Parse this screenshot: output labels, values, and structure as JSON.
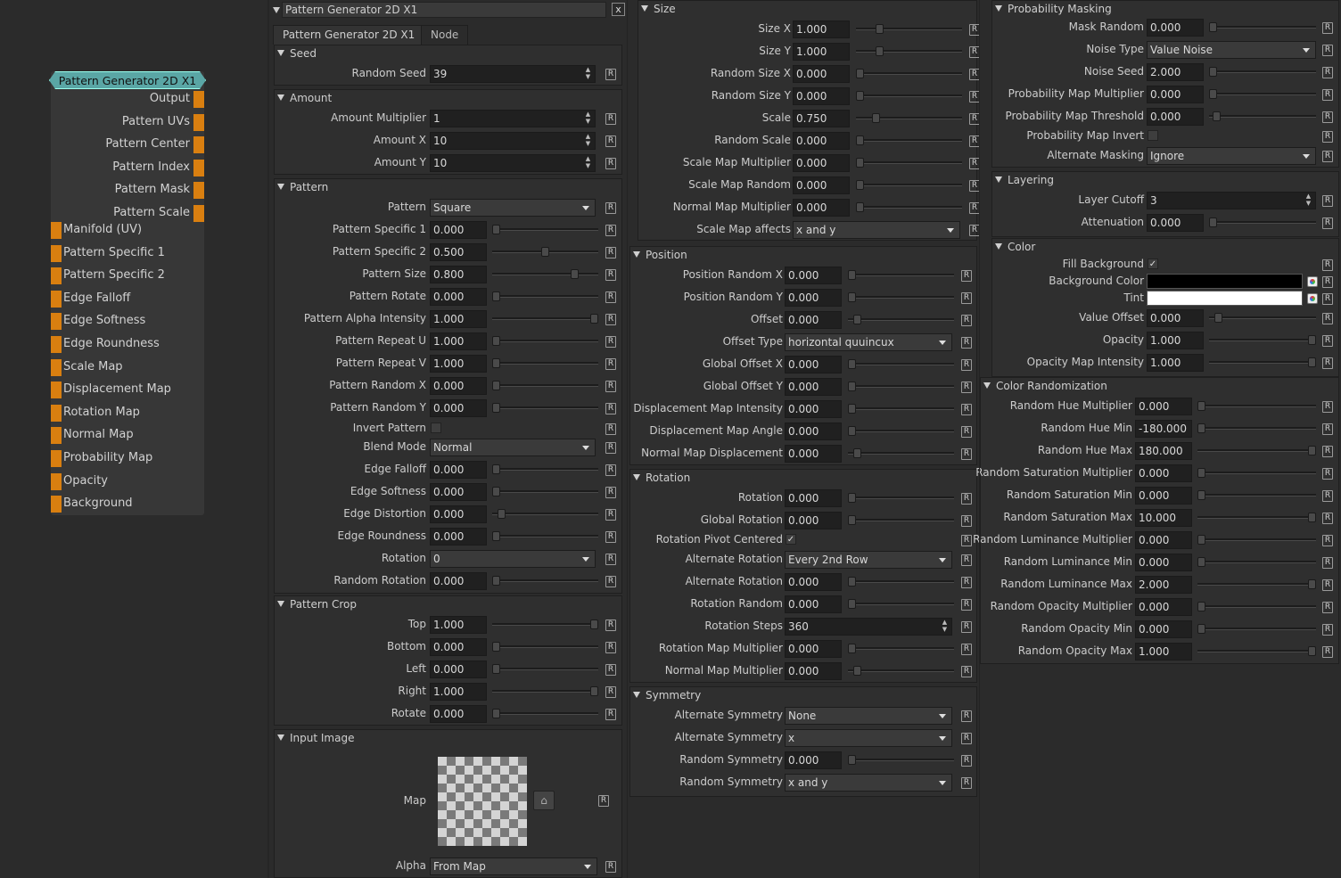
{
  "node": {
    "title": "Pattern Generator 2D X1",
    "outputs": [
      "Output",
      "Pattern UVs",
      "Pattern Center",
      "Pattern Index",
      "Pattern Mask",
      "Pattern Scale"
    ],
    "inputs": [
      "Manifold (UV)",
      "Pattern Specific 1",
      "Pattern Specific 2",
      "Edge Falloff",
      "Edge Softness",
      "Edge Roundness",
      "Scale Map",
      "Displacement Map",
      "Rotation Map",
      "Normal Map",
      "Probability Map",
      "Opacity",
      "Background"
    ],
    "port_color": "#d97f10",
    "title_color": "#5aa6a5"
  },
  "panel": {
    "header_title": "Pattern Generator 2D X1",
    "close_label": "x",
    "tabs": [
      "Pattern Generator 2D X1",
      "Node"
    ],
    "reset_label": "R"
  },
  "col1": [
    {
      "title": "Seed",
      "rows": [
        {
          "label": "Random Seed",
          "value": "39",
          "kind": "spin"
        }
      ]
    },
    {
      "title": "Amount",
      "rows": [
        {
          "label": "Amount Multiplier",
          "value": "1",
          "kind": "spin"
        },
        {
          "label": "Amount X",
          "value": "10",
          "kind": "spin"
        },
        {
          "label": "Amount Y",
          "value": "10",
          "kind": "spin"
        }
      ]
    },
    {
      "title": "Pattern",
      "rows": [
        {
          "label": "Pattern",
          "value": "Square",
          "kind": "dropdown"
        },
        {
          "label": "Pattern Specific 1",
          "value": "0.000",
          "kind": "slider",
          "level": 0
        },
        {
          "label": "Pattern Specific 2",
          "value": "0.500",
          "kind": "slider",
          "level": 0.5
        },
        {
          "label": "Pattern Size",
          "value": "0.800",
          "kind": "slider",
          "level": 0.8
        },
        {
          "label": "Pattern Rotate",
          "value": "0.000",
          "kind": "slider",
          "level": 0
        },
        {
          "label": "Pattern Alpha Intensity",
          "value": "1.000",
          "kind": "slider",
          "level": 1
        },
        {
          "label": "Pattern Repeat U",
          "value": "1.000",
          "kind": "slider",
          "level": 0
        },
        {
          "label": "Pattern Repeat V",
          "value": "1.000",
          "kind": "slider",
          "level": 0
        },
        {
          "label": "Pattern Random X",
          "value": "0.000",
          "kind": "slider",
          "level": 0
        },
        {
          "label": "Pattern Random Y",
          "value": "0.000",
          "kind": "slider",
          "level": 0
        },
        {
          "label": "Invert Pattern",
          "value": "",
          "kind": "check"
        },
        {
          "label": "Blend Mode",
          "value": "Normal",
          "kind": "dropdown"
        },
        {
          "label": "Edge Falloff",
          "value": "0.000",
          "kind": "slider",
          "level": 0
        },
        {
          "label": "Edge Softness",
          "value": "0.000",
          "kind": "slider",
          "level": 0
        },
        {
          "label": "Edge Distortion",
          "value": "0.000",
          "kind": "slider",
          "level": 0.05
        },
        {
          "label": "Edge Roundness",
          "value": "0.000",
          "kind": "slider",
          "level": 0
        },
        {
          "label": "Rotation",
          "value": "0",
          "kind": "dropdown"
        },
        {
          "label": "Random Rotation",
          "value": "0.000",
          "kind": "slider",
          "level": 0
        }
      ]
    },
    {
      "title": "Pattern Crop",
      "rows": [
        {
          "label": "Top",
          "value": "1.000",
          "kind": "slider",
          "level": 1
        },
        {
          "label": "Bottom",
          "value": "0.000",
          "kind": "slider",
          "level": 0
        },
        {
          "label": "Left",
          "value": "0.000",
          "kind": "slider",
          "level": 0
        },
        {
          "label": "Right",
          "value": "1.000",
          "kind": "slider",
          "level": 1
        },
        {
          "label": "Rotate",
          "value": "0.000",
          "kind": "slider",
          "level": 0
        }
      ]
    },
    {
      "title": "Input Image",
      "map_label": "Map",
      "alpha_label": "Alpha",
      "alpha_value": "From Map"
    }
  ],
  "col2": [
    {
      "title": "Size",
      "rows": [
        {
          "label": "Size X",
          "value": "1.000",
          "kind": "slider",
          "level": 0.2
        },
        {
          "label": "Size Y",
          "value": "1.000",
          "kind": "slider",
          "level": 0.2
        },
        {
          "label": "Random Size X",
          "value": "0.000",
          "kind": "slider",
          "level": 0
        },
        {
          "label": "Random Size Y",
          "value": "0.000",
          "kind": "slider",
          "level": 0
        },
        {
          "label": "Scale",
          "value": "0.750",
          "kind": "slider",
          "level": 0.16
        },
        {
          "label": "Random Scale",
          "value": "0.000",
          "kind": "slider",
          "level": 0
        },
        {
          "label": "Scale Map Multiplier",
          "value": "0.000",
          "kind": "slider",
          "level": 0
        },
        {
          "label": "Scale Map Random",
          "value": "0.000",
          "kind": "slider",
          "level": 0
        },
        {
          "label": "Normal Map Multiplier",
          "value": "0.000",
          "kind": "slider",
          "level": 0
        },
        {
          "label": "Scale Map affects",
          "value": "x and y",
          "kind": "dropdown"
        }
      ]
    },
    {
      "title": "Position",
      "rows": [
        {
          "label": "Position Random X",
          "value": "0.000",
          "kind": "slider",
          "level": 0
        },
        {
          "label": "Position Random Y",
          "value": "0.000",
          "kind": "slider",
          "level": 0
        },
        {
          "label": "Offset",
          "value": "0.000",
          "kind": "slider",
          "level": 0.05
        },
        {
          "label": "Offset Type",
          "value": "horizontal quuincux",
          "kind": "dropdown"
        },
        {
          "label": "Global Offset X",
          "value": "0.000",
          "kind": "slider",
          "level": 0
        },
        {
          "label": "Global Offset Y",
          "value": "0.000",
          "kind": "slider",
          "level": 0
        },
        {
          "label": "Displacement Map Intensity",
          "value": "0.000",
          "kind": "slider",
          "level": 0
        },
        {
          "label": "Displacement Map Angle",
          "value": "0.000",
          "kind": "slider",
          "level": 0
        },
        {
          "label": "Normal Map Displacement",
          "value": "0.000",
          "kind": "slider",
          "level": 0.05
        }
      ]
    },
    {
      "title": "Rotation",
      "rows": [
        {
          "label": "Rotation",
          "value": "0.000",
          "kind": "slider",
          "level": 0
        },
        {
          "label": "Global Rotation",
          "value": "0.000",
          "kind": "slider",
          "level": 0
        },
        {
          "label": "Rotation Pivot Centered",
          "value": "✓",
          "kind": "check"
        },
        {
          "label": "Alternate Rotation",
          "value": "Every 2nd Row",
          "kind": "dropdown"
        },
        {
          "label": "Alternate Rotation",
          "value": "0.000",
          "kind": "slider",
          "level": 0
        },
        {
          "label": "Rotation Random",
          "value": "0.000",
          "kind": "slider",
          "level": 0
        },
        {
          "label": "Rotation Steps",
          "value": "360",
          "kind": "spin"
        },
        {
          "label": "Rotation Map Multiplier",
          "value": "0.000",
          "kind": "slider",
          "level": 0
        },
        {
          "label": "Normal Map Multiplier",
          "value": "0.000",
          "kind": "slider",
          "level": 0.05
        }
      ]
    },
    {
      "title": "Symmetry",
      "rows": [
        {
          "label": "Alternate Symmetry",
          "value": "None",
          "kind": "dropdown"
        },
        {
          "label": "Alternate Symmetry",
          "value": "x",
          "kind": "dropdown"
        },
        {
          "label": "Random Symmetry",
          "value": "0.000",
          "kind": "slider",
          "level": 0
        },
        {
          "label": "Random Symmetry",
          "value": "x and y",
          "kind": "dropdown"
        }
      ]
    }
  ],
  "col3": [
    {
      "title": "Probability Masking",
      "rows": [
        {
          "label": "Mask Random",
          "value": "0.000",
          "kind": "slider",
          "level": 0
        },
        {
          "label": "Noise Type",
          "value": "Value Noise",
          "kind": "dropdown"
        },
        {
          "label": "Noise Seed",
          "value": "2.000",
          "kind": "slider",
          "level": 0
        },
        {
          "label": "Probability Map Multiplier",
          "value": "0.000",
          "kind": "slider",
          "level": 0
        },
        {
          "label": "Probability Map Threshold",
          "value": "0.000",
          "kind": "slider",
          "level": 0.04
        },
        {
          "label": "Probability Map Invert",
          "value": "",
          "kind": "check"
        },
        {
          "label": "Alternate Masking",
          "value": "Ignore",
          "kind": "dropdown"
        }
      ]
    },
    {
      "title": "Layering",
      "rows": [
        {
          "label": "Layer Cutoff",
          "value": "3",
          "kind": "spin"
        },
        {
          "label": "Attenuation",
          "value": "0.000",
          "kind": "slider",
          "level": 0
        }
      ]
    },
    {
      "title": "Color",
      "rows": [
        {
          "label": "Fill Background",
          "value": "✓",
          "kind": "check"
        },
        {
          "label": "Background Color",
          "value": "#000000",
          "kind": "color"
        },
        {
          "label": "Tint",
          "value": "#ffffff",
          "kind": "color"
        },
        {
          "label": "Value Offset",
          "value": "0.000",
          "kind": "slider",
          "level": 0.05
        },
        {
          "label": "Opacity",
          "value": "1.000",
          "kind": "slider",
          "level": 1
        },
        {
          "label": "Opacity Map Intensity",
          "value": "1.000",
          "kind": "slider",
          "level": 1
        }
      ]
    },
    {
      "title": "Color Randomization",
      "rows": [
        {
          "label": "Random Hue Multiplier",
          "value": "0.000",
          "kind": "slider",
          "level": 0
        },
        {
          "label": "Random Hue Min",
          "value": "-180.000",
          "kind": "slider",
          "level": 0
        },
        {
          "label": "Random Hue Max",
          "value": "180.000",
          "kind": "slider",
          "level": 1
        },
        {
          "label": "Random Saturation Multiplier",
          "value": "0.000",
          "kind": "slider",
          "level": 0
        },
        {
          "label": "Random Saturation Min",
          "value": "0.000",
          "kind": "slider",
          "level": 0
        },
        {
          "label": "Random Saturation Max",
          "value": "10.000",
          "kind": "slider",
          "level": 1
        },
        {
          "label": "Random Luminance Multiplier",
          "value": "0.000",
          "kind": "slider",
          "level": 0
        },
        {
          "label": "Random Luminance Min",
          "value": "0.000",
          "kind": "slider",
          "level": 0
        },
        {
          "label": "Random Luminance Max",
          "value": "2.000",
          "kind": "slider",
          "level": 1
        },
        {
          "label": "Random Opacity Multiplier",
          "value": "0.000",
          "kind": "slider",
          "level": 0
        },
        {
          "label": "Random Opacity Min",
          "value": "0.000",
          "kind": "slider",
          "level": 0
        },
        {
          "label": "Random Opacity Max",
          "value": "1.000",
          "kind": "slider",
          "level": 1
        }
      ]
    }
  ]
}
